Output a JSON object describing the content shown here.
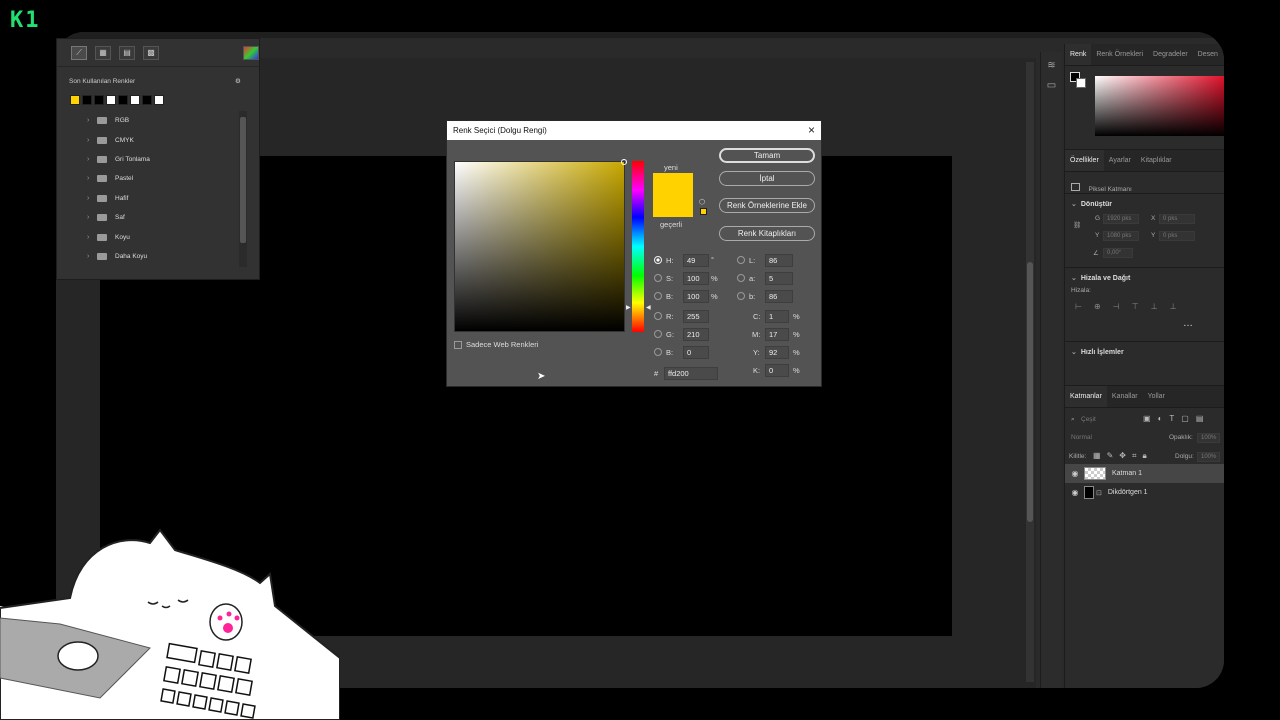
{
  "brand": {
    "logo_text": "K1"
  },
  "swatches_panel": {
    "title": "Son Kullanılan Renkler",
    "recent_colors": [
      "#ffd200",
      "#000000",
      "#000000",
      "#ffffff",
      "#000000",
      "#ffffff",
      "#000000",
      "#ffffff"
    ],
    "folders": [
      "RGB",
      "CMYK",
      "Gri Tonlama",
      "Pastel",
      "Hafif",
      "Saf",
      "Koyu",
      "Daha Koyu"
    ]
  },
  "dialog": {
    "title": "Renk Seçici (Dolgu Rengi)",
    "new_label": "yeni",
    "current_label": "geçerli",
    "new_color": "#ffd200",
    "current_color": "#ffd200",
    "ok_label": "Tamam",
    "cancel_label": "İptal",
    "add_to_swatches_label": "Renk Örneklerine Ekle",
    "libraries_label": "Renk Kitaplıkları",
    "web_only_label": "Sadece Web Renkleri",
    "fields": {
      "h_label": "H:",
      "h": "49",
      "h_unit": "°",
      "s_label": "S:",
      "s": "100",
      "s_unit": "%",
      "bright_label": "B:",
      "bright": "100",
      "bright_unit": "%",
      "r_label": "R:",
      "r": "255",
      "g_label": "G:",
      "g": "210",
      "b_label": "B:",
      "b": "0",
      "l_label": "L:",
      "l": "86",
      "a_label": "a:",
      "a": "5",
      "bb_label": "b:",
      "bb": "86",
      "c_label": "C:",
      "c": "1",
      "m_label": "M:",
      "m": "17",
      "y_label": "Y:",
      "y": "92",
      "k_label": "K:",
      "k": "0",
      "pct": "%",
      "hex_label": "#",
      "hex": "ffd200"
    }
  },
  "right_panel": {
    "color_tabs": [
      "Renk",
      "Renk Örnekleri",
      "Degradeler",
      "Desen"
    ],
    "prop_tabs": [
      "Özellikler",
      "Ayarlar",
      "Kitaplıklar"
    ],
    "pixel_layer_label": "Piksel Katmanı",
    "transform_title": "Dönüştür",
    "transform_fields": {
      "w_label": "G",
      "w": "1920 pks",
      "x_label": "X",
      "x": "0 pks",
      "h_label": "Y",
      "h": "1080 pks",
      "y_label": "Y",
      "y": "0 pks",
      "angle": "0,00°"
    },
    "align_title": "Hizala ve Dağıt",
    "align_label": "Hizala:",
    "quick_title": "Hızlı İşlemler",
    "layer_tabs": [
      "Katmanlar",
      "Kanallar",
      "Yollar"
    ],
    "kind_label": "Çeşit",
    "blend_mode": "Normal",
    "opacity_label": "Opaklık:",
    "opacity": "100%",
    "lock_label": "Kilitle:",
    "fill_label": "Dolgu:",
    "fill": "100%",
    "layers": [
      "Katman 1",
      "Dikdörtgen 1"
    ]
  }
}
